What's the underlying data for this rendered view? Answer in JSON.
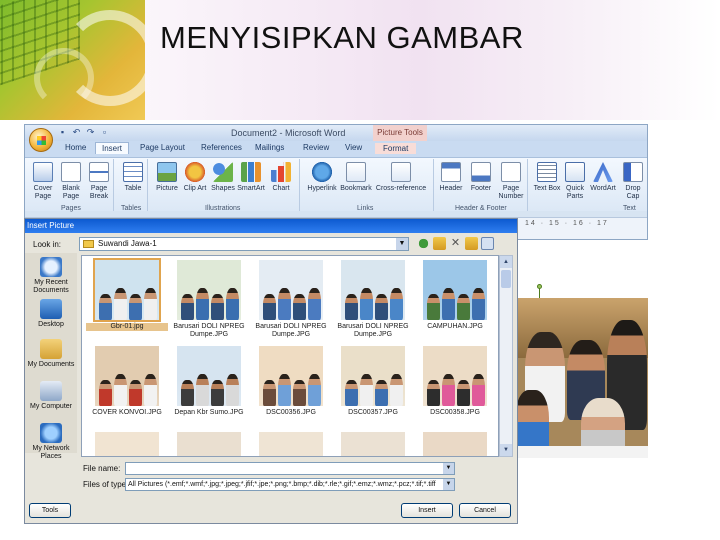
{
  "slide": {
    "title": "MENYISIPKAN GAMBAR"
  },
  "word": {
    "document_title": "Document2 - Microsoft Word",
    "contextual_tab_group": "Picture Tools",
    "tabs": [
      "Home",
      "Insert",
      "Page Layout",
      "References",
      "Mailings",
      "Review",
      "View",
      "Format"
    ],
    "active_tab": "Insert",
    "ribbon_buttons": [
      {
        "label": "Cover Page",
        "icon": "cover-page-icon"
      },
      {
        "label": "Blank Page",
        "icon": "blank-page-icon"
      },
      {
        "label": "Page Break",
        "icon": "page-break-icon"
      },
      {
        "label": "Table",
        "icon": "table-icon"
      },
      {
        "label": "Picture",
        "icon": "picture-icon"
      },
      {
        "label": "Clip Art",
        "icon": "clip-art-icon"
      },
      {
        "label": "Shapes",
        "icon": "shapes-icon"
      },
      {
        "label": "SmartArt",
        "icon": "smartart-icon"
      },
      {
        "label": "Chart",
        "icon": "chart-icon"
      },
      {
        "label": "Hyperlink",
        "icon": "hyperlink-icon"
      },
      {
        "label": "Bookmark",
        "icon": "bookmark-icon"
      },
      {
        "label": "Cross-reference",
        "icon": "cross-reference-icon"
      },
      {
        "label": "Header",
        "icon": "header-icon"
      },
      {
        "label": "Footer",
        "icon": "footer-icon"
      },
      {
        "label": "Page Number",
        "icon": "page-number-icon"
      },
      {
        "label": "Text Box",
        "icon": "text-box-icon"
      },
      {
        "label": "Quick Parts",
        "icon": "quick-parts-icon"
      },
      {
        "label": "WordArt",
        "icon": "wordart-icon"
      },
      {
        "label": "Drop Cap",
        "icon": "drop-cap-icon"
      }
    ],
    "groups": [
      "Pages",
      "Tables",
      "Illustrations",
      "Links",
      "Header & Footer",
      "Text"
    ],
    "ruler_scale": "14 · 15 · 16 · 17"
  },
  "dialog": {
    "title": "Insert Picture",
    "look_in_label": "Look in:",
    "look_in_value": "Suwandi Jawa-1",
    "places": [
      "My Recent Documents",
      "Desktop",
      "My Documents",
      "My Computer",
      "My Network Places"
    ],
    "files": [
      {
        "name": "Gbr-01.jpg",
        "selected": true
      },
      {
        "name": "Barusari DOLI NPREG Dumpe.JPG",
        "selected": false
      },
      {
        "name": "Barusari DOLI NPREG Dumpe.JPG",
        "selected": false
      },
      {
        "name": "Barusari DOLI NPREG Dumpe.JPG",
        "selected": false
      },
      {
        "name": "CAMPUHAN.JPG",
        "selected": false
      },
      {
        "name": "COVER KONVOI.JPG",
        "selected": false
      },
      {
        "name": "Depan Kbr Sumo.JPG",
        "selected": false
      },
      {
        "name": "DSC00356.JPG",
        "selected": false
      },
      {
        "name": "DSC00357.JPG",
        "selected": false
      },
      {
        "name": "DSC00358.JPG",
        "selected": false
      },
      {
        "name": "",
        "selected": false
      },
      {
        "name": "",
        "selected": false
      },
      {
        "name": "",
        "selected": false
      },
      {
        "name": "",
        "selected": false
      },
      {
        "name": "",
        "selected": false
      }
    ],
    "file_name_label": "File name:",
    "file_name_value": "",
    "files_of_type_label": "Files of type:",
    "files_of_type_value": "All Pictures (*.emf;*.wmf;*.jpg;*.jpeg;*.jfif;*.jpe;*.png;*.bmp;*.dib;*.rle;*.gif;*.emz;*.wmz;*.pcz;*.tif;*.tiff",
    "tools_label": "Tools",
    "insert_label": "Insert",
    "cancel_label": "Cancel"
  },
  "colors": {
    "accent_green": "#7dbb2c",
    "ribbon_blue": "#d7e4f2",
    "dialog_title_blue": "#0d5ad0",
    "selection": "#e0a44e"
  }
}
